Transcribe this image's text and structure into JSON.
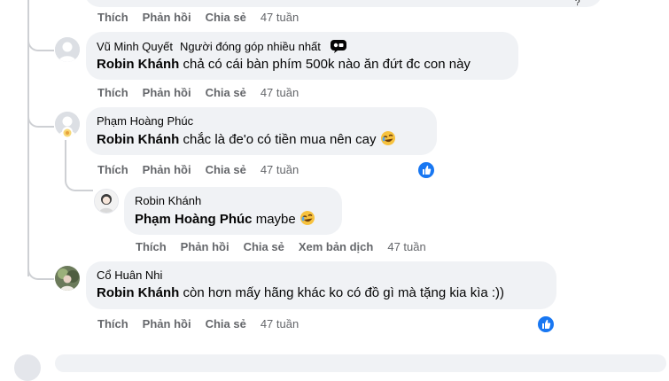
{
  "top_actions": {
    "like": "Thích",
    "reply": "Phản hồi",
    "share": "Chia sẻ",
    "time": "47 tuần"
  },
  "comments": [
    {
      "author": "Vũ Minh Quyết",
      "badge": "Người đóng góp nhiều nhất",
      "mention": "Robin Khánh",
      "text": "chả có cái bàn phím 500k nào ăn đứt đc con này",
      "actions": {
        "like": "Thích",
        "reply": "Phản hồi",
        "share": "Chia sẻ",
        "time": "47 tuần"
      }
    },
    {
      "author": "Phạm Hoàng Phúc",
      "mention": "Robin Khánh",
      "text": "chắc là đe'o có tiền mua nên cay",
      "actions": {
        "like": "Thích",
        "reply": "Phản hồi",
        "share": "Chia sẻ",
        "time": "47 tuần"
      }
    },
    {
      "author": "Robin Khánh",
      "mention": "Phạm Hoàng Phúc",
      "text": "maybe",
      "actions": {
        "like": "Thích",
        "reply": "Phản hồi",
        "share": "Chia sẻ",
        "translate": "Xem bản dịch",
        "time": "47 tuần"
      }
    },
    {
      "author": "Cổ Huân Nhi",
      "mention": "Robin Khánh",
      "text": "còn hơn mấy hãng khác ko có đồ gì mà tặng kia kìa :))",
      "actions": {
        "like": "Thích",
        "reply": "Phản hồi",
        "share": "Chia sẻ",
        "time": "47 tuần"
      }
    }
  ],
  "colors": {
    "bubble": "#f0f2f5",
    "meta": "#65676b",
    "like_blue": "#1877f2",
    "line": "#ced0d4"
  },
  "icons": [
    "default-avatar-icon",
    "top-fan-badge-icon",
    "laughing-emoji-icon",
    "like-reaction-icon"
  ]
}
